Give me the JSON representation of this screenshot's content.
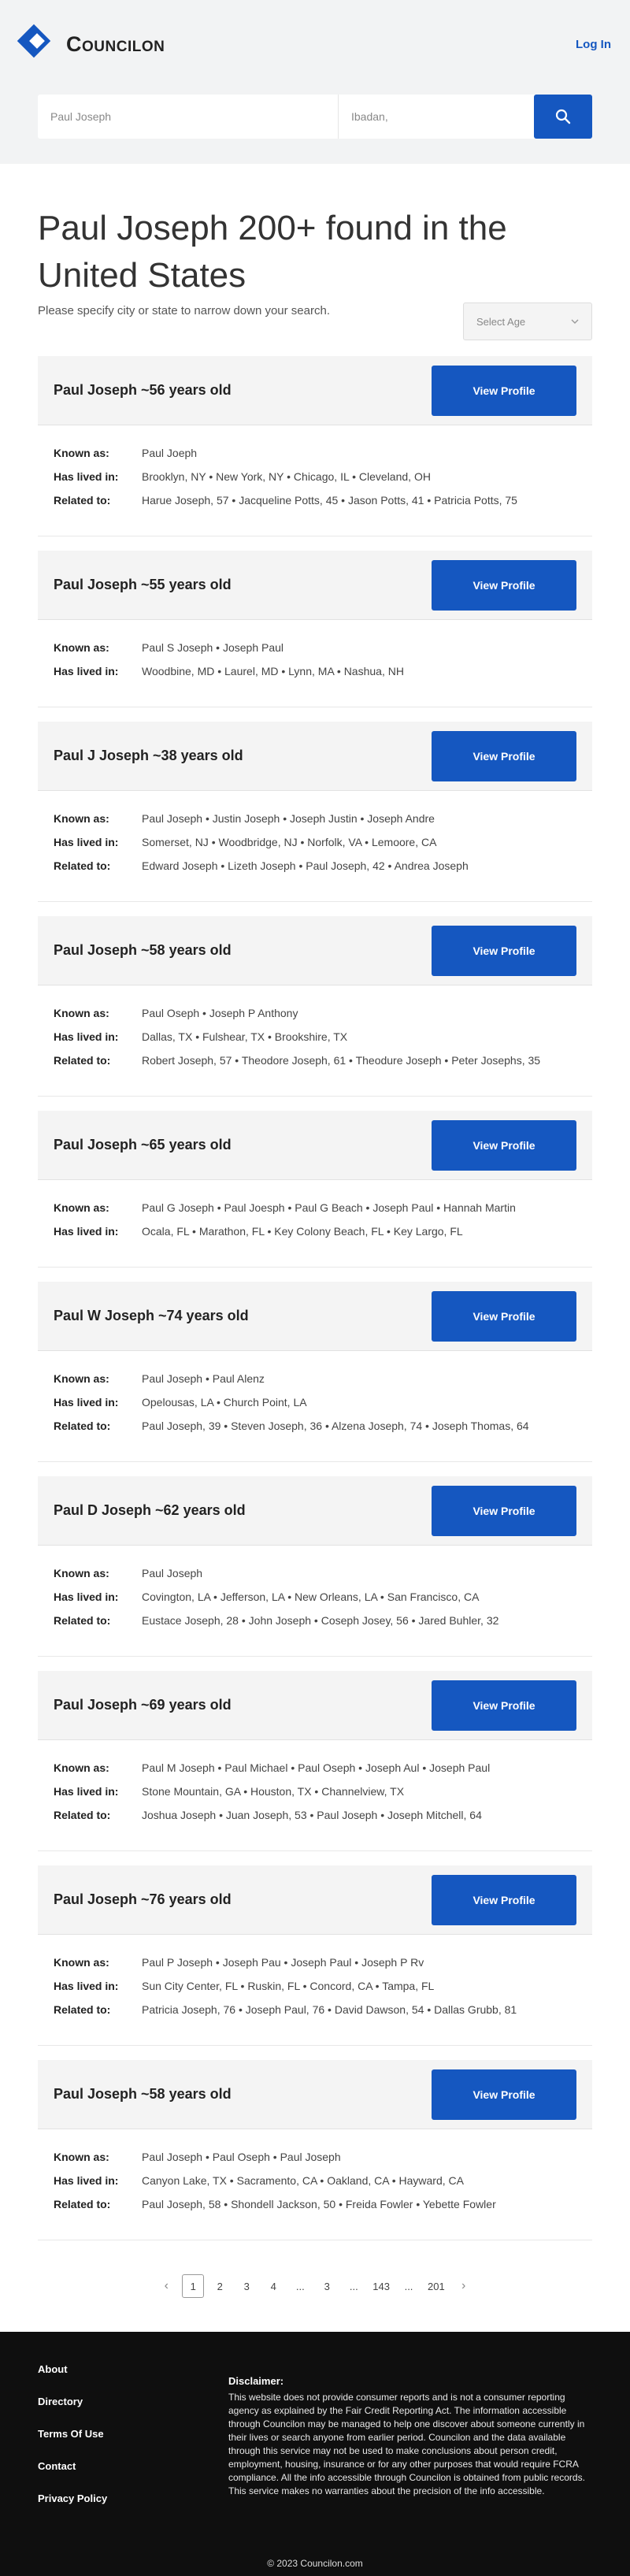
{
  "header": {
    "brand": "Councilon",
    "login_label": "Log In"
  },
  "search": {
    "name_value": "Paul Joseph",
    "location_value": "Ibadan,"
  },
  "main": {
    "title": "Paul Joseph 200+ found in the United States",
    "subtitle": "Please specify city or state to narrow down your search.",
    "age_select_label": "Select Age",
    "view_profile_label": "View Profile",
    "labels": {
      "known_as": "Known as:",
      "has_lived_in": "Has lived in:",
      "related_to": "Related to:"
    }
  },
  "results": [
    {
      "name": "Paul Joseph ~56 years old",
      "known_as": "Paul Joeph",
      "has_lived_in": "Brooklyn, NY • New York, NY • Chicago, IL • Cleveland, OH",
      "related_to": "Harue Joseph, 57 • Jacqueline Potts, 45 • Jason Potts, 41 • Patricia Potts, 75"
    },
    {
      "name": "Paul Joseph ~55 years old",
      "known_as": "Paul S Joseph • Joseph Paul",
      "has_lived_in": "Woodbine, MD • Laurel, MD • Lynn, MA • Nashua, NH",
      "related_to": ""
    },
    {
      "name": "Paul J Joseph ~38 years old",
      "known_as": "Paul Joseph • Justin Joseph • Joseph Justin • Joseph Andre",
      "has_lived_in": "Somerset, NJ • Woodbridge, NJ • Norfolk, VA • Lemoore, CA",
      "related_to": "Edward Joseph • Lizeth Joseph • Paul Joseph, 42 • Andrea Joseph"
    },
    {
      "name": "Paul Joseph ~58 years old",
      "known_as": "Paul Oseph • Joseph P Anthony",
      "has_lived_in": "Dallas, TX • Fulshear, TX • Brookshire, TX",
      "related_to": "Robert Joseph, 57 • Theodore Joseph, 61 • Theodure Joseph • Peter Josephs, 35"
    },
    {
      "name": "Paul Joseph ~65 years old",
      "known_as": "Paul G Joseph • Paul Joesph • Paul G Beach • Joseph Paul • Hannah Martin",
      "has_lived_in": "Ocala, FL • Marathon, FL • Key Colony Beach, FL • Key Largo, FL",
      "related_to": ""
    },
    {
      "name": "Paul W Joseph ~74 years old",
      "known_as": "Paul Joseph • Paul Alenz",
      "has_lived_in": "Opelousas, LA • Church Point, LA",
      "related_to": "Paul Joseph, 39 • Steven Joseph, 36 • Alzena Joseph, 74 • Joseph Thomas, 64"
    },
    {
      "name": "Paul D Joseph ~62 years old",
      "known_as": "Paul Joseph",
      "has_lived_in": "Covington, LA • Jefferson, LA • New Orleans, LA • San Francisco, CA",
      "related_to": "Eustace Joseph, 28 • John Joseph • Coseph Josey, 56 • Jared Buhler, 32"
    },
    {
      "name": "Paul Joseph ~69 years old",
      "known_as": "Paul M Joseph • Paul Michael • Paul Oseph • Joseph Aul • Joseph Paul",
      "has_lived_in": "Stone Mountain, GA • Houston, TX • Channelview, TX",
      "related_to": "Joshua Joseph • Juan Joseph, 53 • Paul Joseph • Joseph Mitchell, 64"
    },
    {
      "name": "Paul Joseph ~76 years old",
      "known_as": "Paul P Joseph • Joseph Pau • Joseph Paul • Joseph P Rv",
      "has_lived_in": "Sun City Center, FL • Ruskin, FL • Concord, CA • Tampa, FL",
      "related_to": "Patricia Joseph, 76 • Joseph Paul, 76 • David Dawson, 54 • Dallas Grubb, 81"
    },
    {
      "name": "Paul Joseph ~58 years old",
      "known_as": "Paul Joseph • Paul Oseph • Paul Joseph",
      "has_lived_in": "Canyon Lake, TX • Sacramento, CA • Oakland, CA • Hayward, CA",
      "related_to": "Paul Joseph, 58 • Shondell Jackson, 50 • Freida Fowler • Yebette Fowler"
    }
  ],
  "pagination": {
    "prev": "‹",
    "next": "›",
    "pages": [
      "1",
      "2",
      "3",
      "4",
      "...",
      "3",
      "...",
      "143",
      "...",
      "201"
    ],
    "current": "1"
  },
  "footer": {
    "links": [
      "About",
      "Directory",
      "Terms Of Use",
      "Contact",
      "Privacy Policy"
    ],
    "disclaimer_title": "Disclaimer:",
    "disclaimer_text": "This website does not provide consumer reports and is not a consumer reporting agency as explained by the Fair Credit Reporting Act. The information accessible through Councilon may be managed to help one discover about someone currently in their lives or search anyone from earlier period. Councilon and the data available through this service may not be used to make conclusions about person credit, employment, housing, insurance or for any other purposes that would require FCRA compliance. All the info accessible through Councilon is obtained from public records. This service makes no warranties about the precision of the info accessible.",
    "copyright": "© 2023 Councilon.com"
  },
  "colors": {
    "accent": "#1557c0",
    "footer_bg": "#0f0f0f"
  }
}
